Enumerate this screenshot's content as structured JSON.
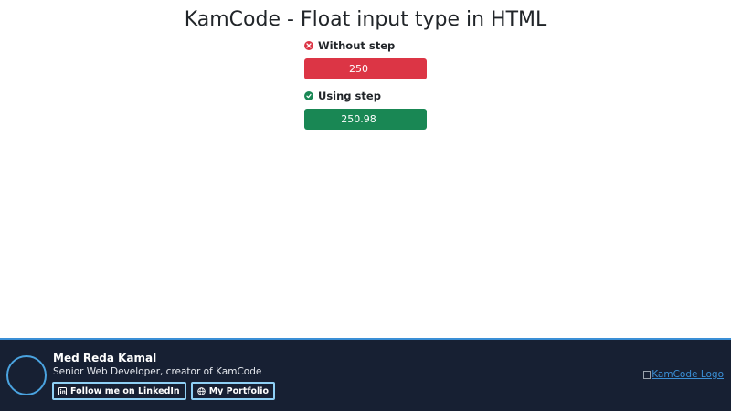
{
  "page": {
    "title": "KamCode - Float input type in HTML"
  },
  "fields": [
    {
      "label": "Without step",
      "value": "250",
      "status": "error",
      "color": "#dc3545",
      "icon": "x-circle-icon"
    },
    {
      "label": "Using step",
      "value": "250.98",
      "status": "success",
      "color": "#198754",
      "icon": "check-circle-icon"
    }
  ],
  "footer": {
    "author_name": "Med Reda Kamal",
    "author_role": "Senior Web Developer, creator of KamCode",
    "linkedin_label": "Follow me on LinkedIn",
    "portfolio_label": "My Portfolio",
    "logo_alt": "KamCode Logo",
    "background": "#172033",
    "accent": "#3a8fd6"
  }
}
